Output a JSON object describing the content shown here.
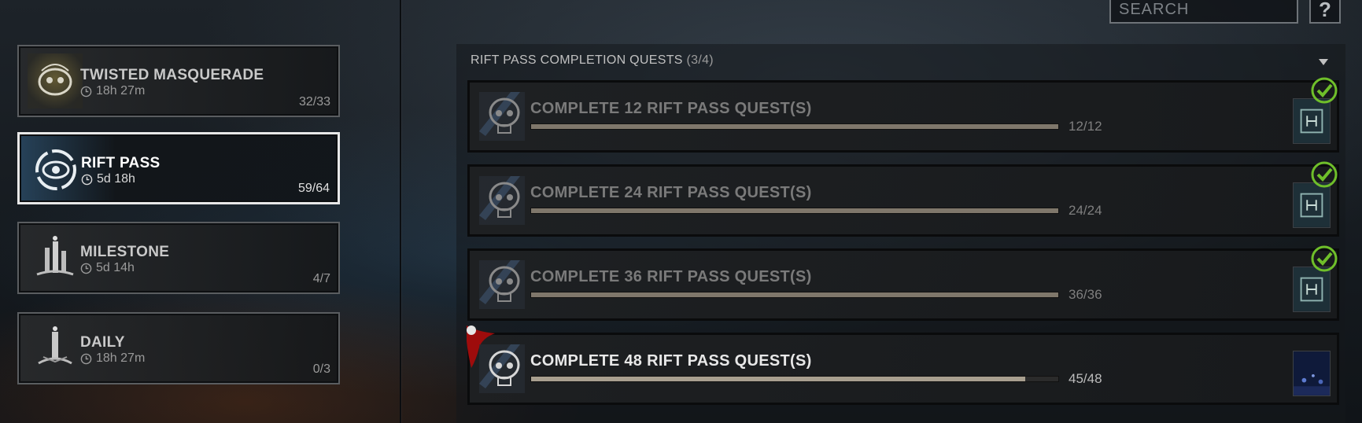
{
  "search": {
    "placeholder": "SEARCH"
  },
  "help_button": {
    "label": "?"
  },
  "categories": [
    {
      "title": "TWISTED MASQUERADE",
      "timer": "18h 27m",
      "count": "32/33",
      "icon": "mask-icon"
    },
    {
      "title": "RIFT PASS",
      "timer": "5d 18h",
      "count": "59/64",
      "icon": "rift-eye-icon",
      "selected": true
    },
    {
      "title": "MILESTONE",
      "timer": "5d 14h",
      "count": "4/7",
      "icon": "candles-icon"
    },
    {
      "title": "DAILY",
      "timer": "18h 27m",
      "count": "0/3",
      "icon": "candle-icon"
    }
  ],
  "section": {
    "title": "RIFT PASS COMPLETION QUESTS",
    "progress": "(3/4)"
  },
  "quests": [
    {
      "title": "COMPLETE 12 RIFT PASS QUEST(S)",
      "count": "12/12",
      "progress": 1.0,
      "completed": true,
      "reward_icon": "charm-reward-icon"
    },
    {
      "title": "COMPLETE 24 RIFT PASS QUEST(S)",
      "count": "24/24",
      "progress": 1.0,
      "completed": true,
      "reward_icon": "charm-reward-icon"
    },
    {
      "title": "COMPLETE 36 RIFT PASS QUEST(S)",
      "count": "36/36",
      "progress": 1.0,
      "completed": true,
      "reward_icon": "charm-reward-icon"
    },
    {
      "title": "COMPLETE 48 RIFT PASS QUEST(S)",
      "count": "45/48",
      "progress": 0.9375,
      "completed": false,
      "reward_icon": "banner-reward-icon"
    }
  ],
  "colors": {
    "check_green": "#6fbf2a",
    "blood_red": "#9e0c0c",
    "bar_fill": "#a89f8f"
  }
}
